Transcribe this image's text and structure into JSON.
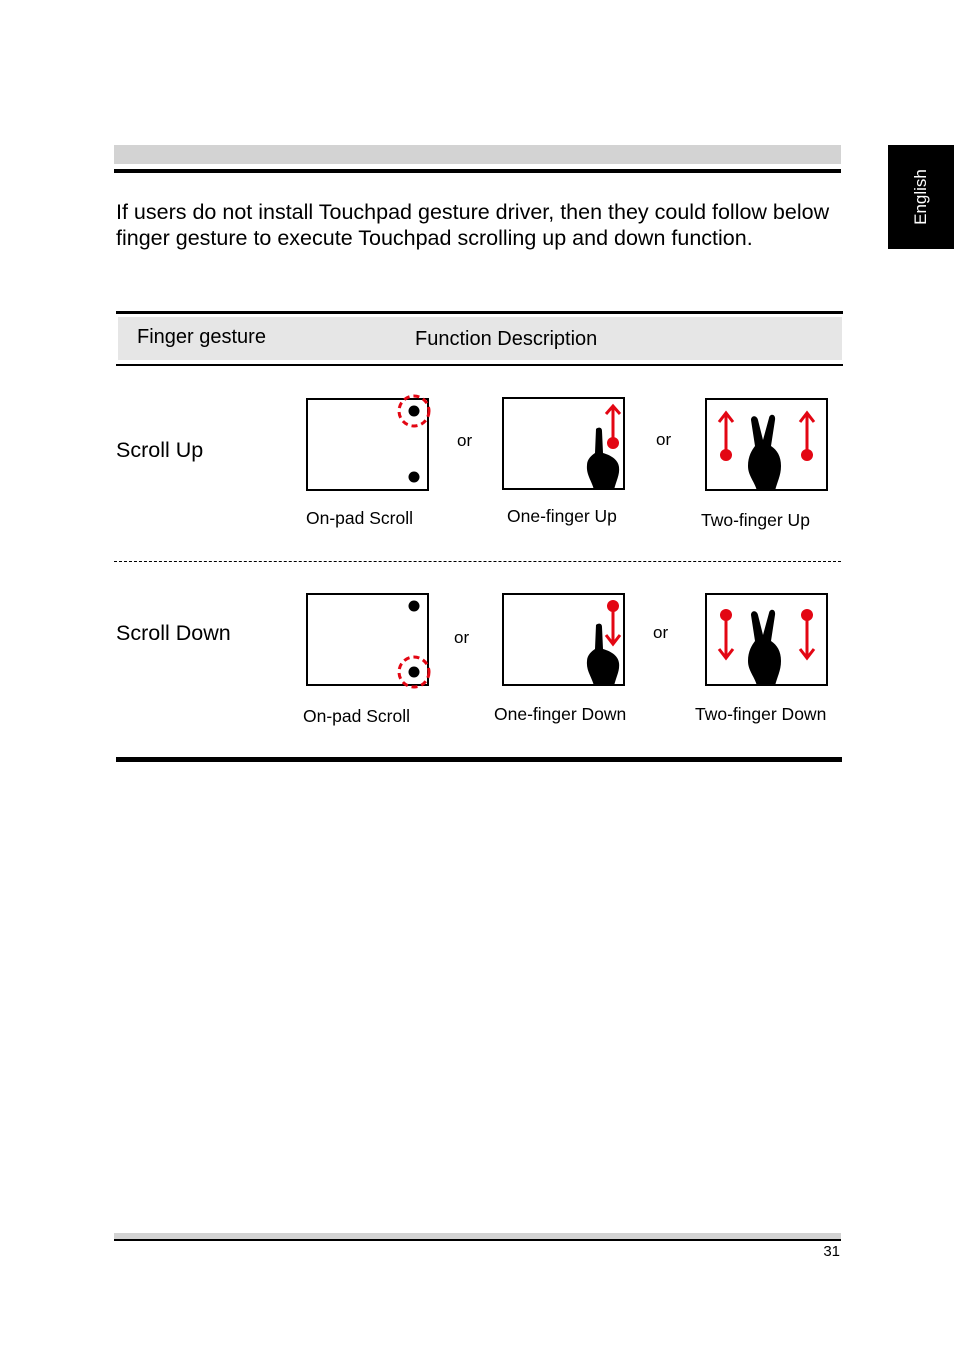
{
  "side_tab": {
    "label": "English"
  },
  "intro": {
    "text": "If users do not install Touchpad gesture driver, then they could follow below finger gesture to execute Touchpad scrolling up and down function."
  },
  "table": {
    "headers": [
      "Finger gesture",
      "Function Description"
    ],
    "rows": [
      {
        "label": "Scroll Up",
        "direction": "up",
        "gestures": [
          {
            "caption": "On-pad Scroll",
            "icon": "on-pad-scroll-up"
          },
          {
            "caption": "One-finger Up",
            "icon": "one-finger-up"
          },
          {
            "caption": "Two-finger Up",
            "icon": "two-finger-up"
          }
        ],
        "separator": "or"
      },
      {
        "label": "Scroll Down",
        "direction": "down",
        "gestures": [
          {
            "caption": "On-pad Scroll",
            "icon": "on-pad-scroll-down"
          },
          {
            "caption": "One-finger Down",
            "icon": "one-finger-down"
          },
          {
            "caption": "Two-finger Down",
            "icon": "two-finger-down"
          }
        ],
        "separator": "or"
      }
    ]
  },
  "colors": {
    "accent": "#e30613",
    "ink": "#000000",
    "header_bg": "#e6e6e6",
    "bar_gray": "#d3d3d3"
  },
  "footer": {
    "page_number": "31"
  }
}
